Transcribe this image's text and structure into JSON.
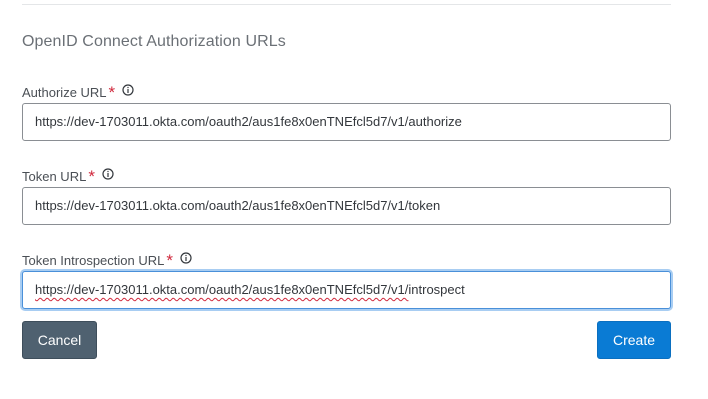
{
  "section": {
    "title": "OpenID Connect Authorization URLs"
  },
  "fields": {
    "authorize": {
      "label": "Authorize URL",
      "required_mark": "*",
      "value": "https://dev-1703011.okta.com/oauth2/aus1fe8x0enTNEfcl5d7/v1/authorize"
    },
    "token": {
      "label": "Token URL",
      "required_mark": "*",
      "value": "https://dev-1703011.okta.com/oauth2/aus1fe8x0enTNEfcl5d7/v1/token"
    },
    "introspection": {
      "label": "Token Introspection URL",
      "required_mark": "*",
      "value_parts": [
        "https://dev-1703011.okta.com/oauth2/aus1fe8x0enTNEfcl5d7/v1/",
        "introspect"
      ]
    }
  },
  "icons": {
    "info": "info-circle-icon"
  },
  "buttons": {
    "cancel": "Cancel",
    "create": "Create"
  },
  "colors": {
    "required": "#d0273b",
    "cancel_bg": "#4f6170",
    "create_bg": "#0a7bd4",
    "focus_ring": "#a8cdf2"
  }
}
